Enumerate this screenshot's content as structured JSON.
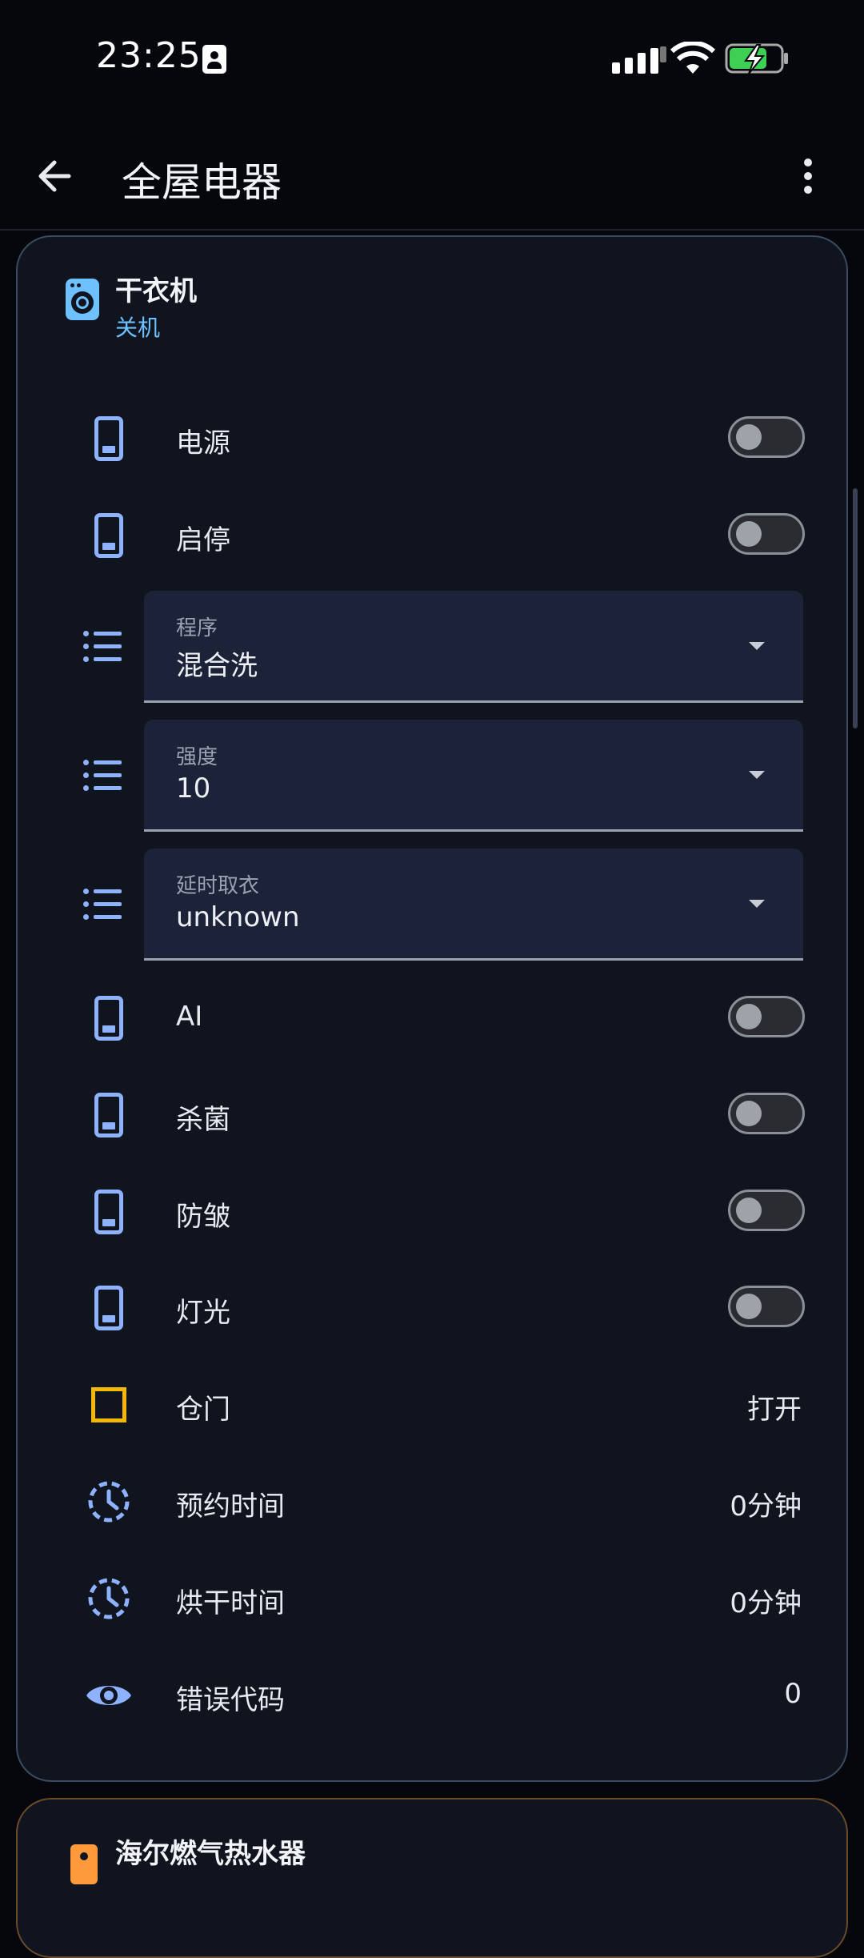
{
  "status_bar": {
    "time": "23:25"
  },
  "app_bar": {
    "title": "全屋电器"
  },
  "device": {
    "name": "干衣机",
    "status": "关机",
    "accent_color": "#6ec0ff",
    "toggles_top": [
      {
        "label": "电源",
        "on": false
      },
      {
        "label": "启停",
        "on": false
      }
    ],
    "selects": [
      {
        "label": "程序",
        "value": "混合洗"
      },
      {
        "label": "强度",
        "value": "10"
      },
      {
        "label": "延时取衣",
        "value": "unknown"
      }
    ],
    "toggles_bottom": [
      {
        "label": "AI",
        "on": false
      },
      {
        "label": "杀菌",
        "on": false
      },
      {
        "label": "防皱",
        "on": false
      },
      {
        "label": "灯光",
        "on": false
      }
    ],
    "door": {
      "label": "仓门",
      "value": "打开"
    },
    "schedule": {
      "label": "预约时间",
      "value": "0分钟"
    },
    "dry_time": {
      "label": "烘干时间",
      "value": "0分钟"
    },
    "error": {
      "label": "错误代码",
      "value": "0"
    }
  },
  "device2": {
    "name": "海尔燃气热水器",
    "accent_color": "#ff9a3c"
  }
}
